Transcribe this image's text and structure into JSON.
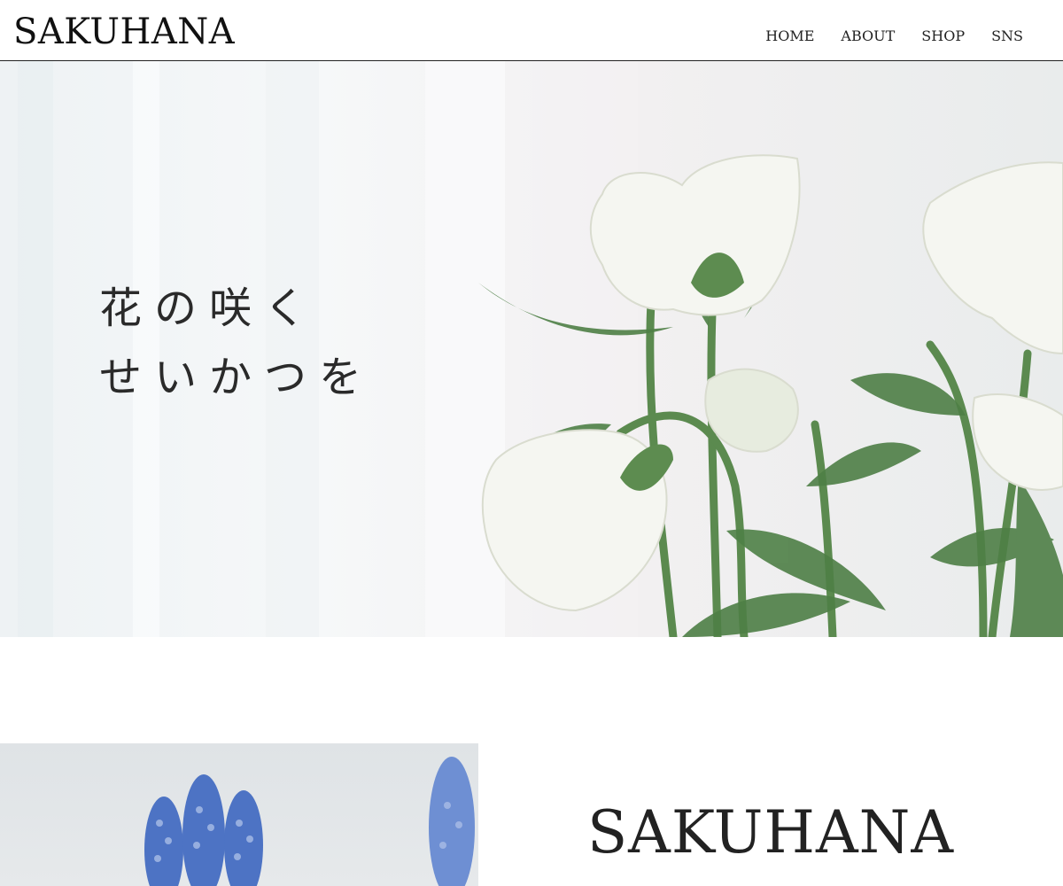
{
  "header": {
    "brand": "SAKUHANA",
    "nav": [
      {
        "label": "HOME"
      },
      {
        "label": "ABOUT"
      },
      {
        "label": "SHOP"
      },
      {
        "label": "SNS"
      }
    ]
  },
  "hero": {
    "lines": [
      "花の咲く",
      "せいかつを"
    ],
    "image": "white-roses-photo"
  },
  "about": {
    "title": "SAKUHANA",
    "subtitle": "",
    "image": "blue-muscari-photo"
  }
}
